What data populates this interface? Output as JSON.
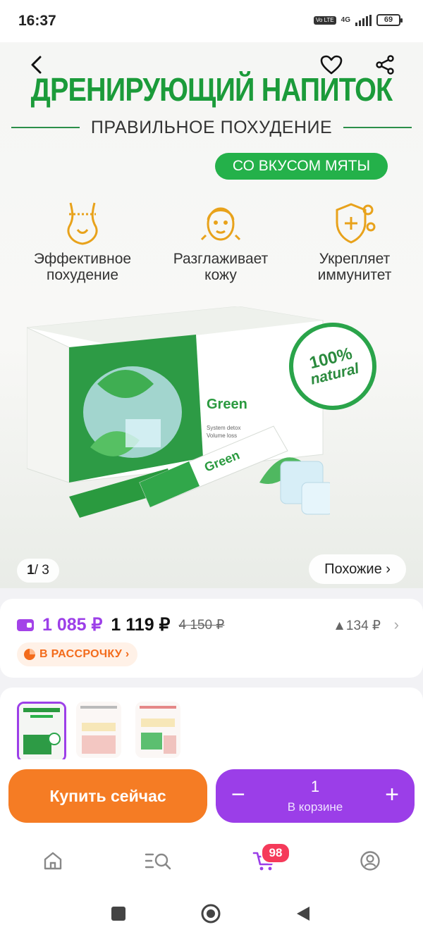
{
  "status_bar": {
    "time": "16:37",
    "network": "4G",
    "volte": "Vo LTE",
    "battery": "69"
  },
  "banner": {
    "title": "ДРЕНИРУЮЩИЙ НАПИТОК",
    "subtitle": "ПРАВИЛЬНОЕ ПОХУДЕНИЕ",
    "flavor": "СО ВКУСОМ МЯТЫ",
    "features": [
      {
        "icon": "waist-icon",
        "label": "Эффективное\nпохудение"
      },
      {
        "icon": "face-icon",
        "label": "Разглаживает\nкожу"
      },
      {
        "icon": "shield-plus-icon",
        "label": "Укрепляет\nиммунитет"
      }
    ],
    "box_brand": "Green",
    "stick_brand": "Green",
    "natural_badge": {
      "line1": "100%",
      "line2": "natural"
    },
    "counter": {
      "current": "1",
      "total": "/ 3"
    },
    "similar_label": "Похожие ›"
  },
  "price": {
    "card_price": "1 085 ₽",
    "price": "1 119 ₽",
    "old_price": "4 150 ₽",
    "delta": "▲134 ₽",
    "installment": "В РАССРОЧКУ ›"
  },
  "actions": {
    "buy_label": "Купить сейчас",
    "quantity": "1",
    "in_cart_label": "В корзине",
    "minus": "−",
    "plus": "+"
  },
  "bottom_nav": {
    "cart_badge": "98",
    "items": [
      "home-icon",
      "catalog-search-icon",
      "cart-icon",
      "profile-icon"
    ]
  },
  "colors": {
    "accent": "#9b3ee8",
    "buy": "#f57c24",
    "brand_green": "#1b9b3a",
    "badge": "#f53a5a"
  }
}
